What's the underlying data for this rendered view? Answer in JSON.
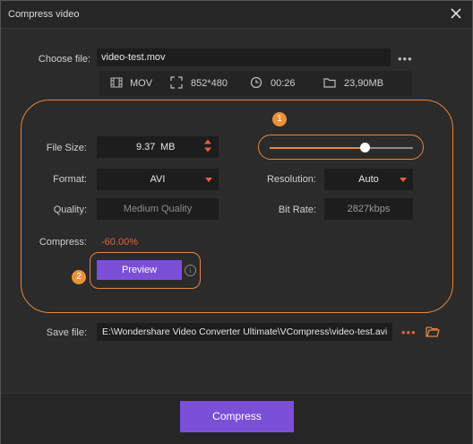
{
  "window": {
    "title": "Compress video"
  },
  "choose_file": {
    "label": "Choose file:",
    "value": "video-test.mov",
    "more": "•••"
  },
  "info": {
    "format": "MOV",
    "resolution": "852*480",
    "duration": "00:26",
    "size": "23,90MB"
  },
  "badges": {
    "one": "1",
    "two": "2"
  },
  "file_size": {
    "label": "File Size:",
    "value": "9.37",
    "unit": "MB"
  },
  "slider": {
    "level": 0.66
  },
  "format": {
    "label": "Format:",
    "value": "AVI"
  },
  "resolution": {
    "label": "Resolution:",
    "value": "Auto"
  },
  "quality": {
    "label": "Quality:",
    "placeholder": "Medium Quality"
  },
  "bitrate": {
    "label": "Bit Rate:",
    "value": "2827kbps"
  },
  "compress_ratio": {
    "label": "Compress:",
    "value": "-60.00%"
  },
  "preview": {
    "label": "Preview",
    "info": "i"
  },
  "save_file": {
    "label": "Save file:",
    "value": "E:\\Wondershare Video Converter Ultimate\\VCompress\\video-test.avi",
    "more": "•••"
  },
  "actions": {
    "compress_label": "Compress"
  },
  "colors": {
    "accent": "#e8853a",
    "button": "#7b4fd6",
    "ratio": "#e8603a"
  }
}
